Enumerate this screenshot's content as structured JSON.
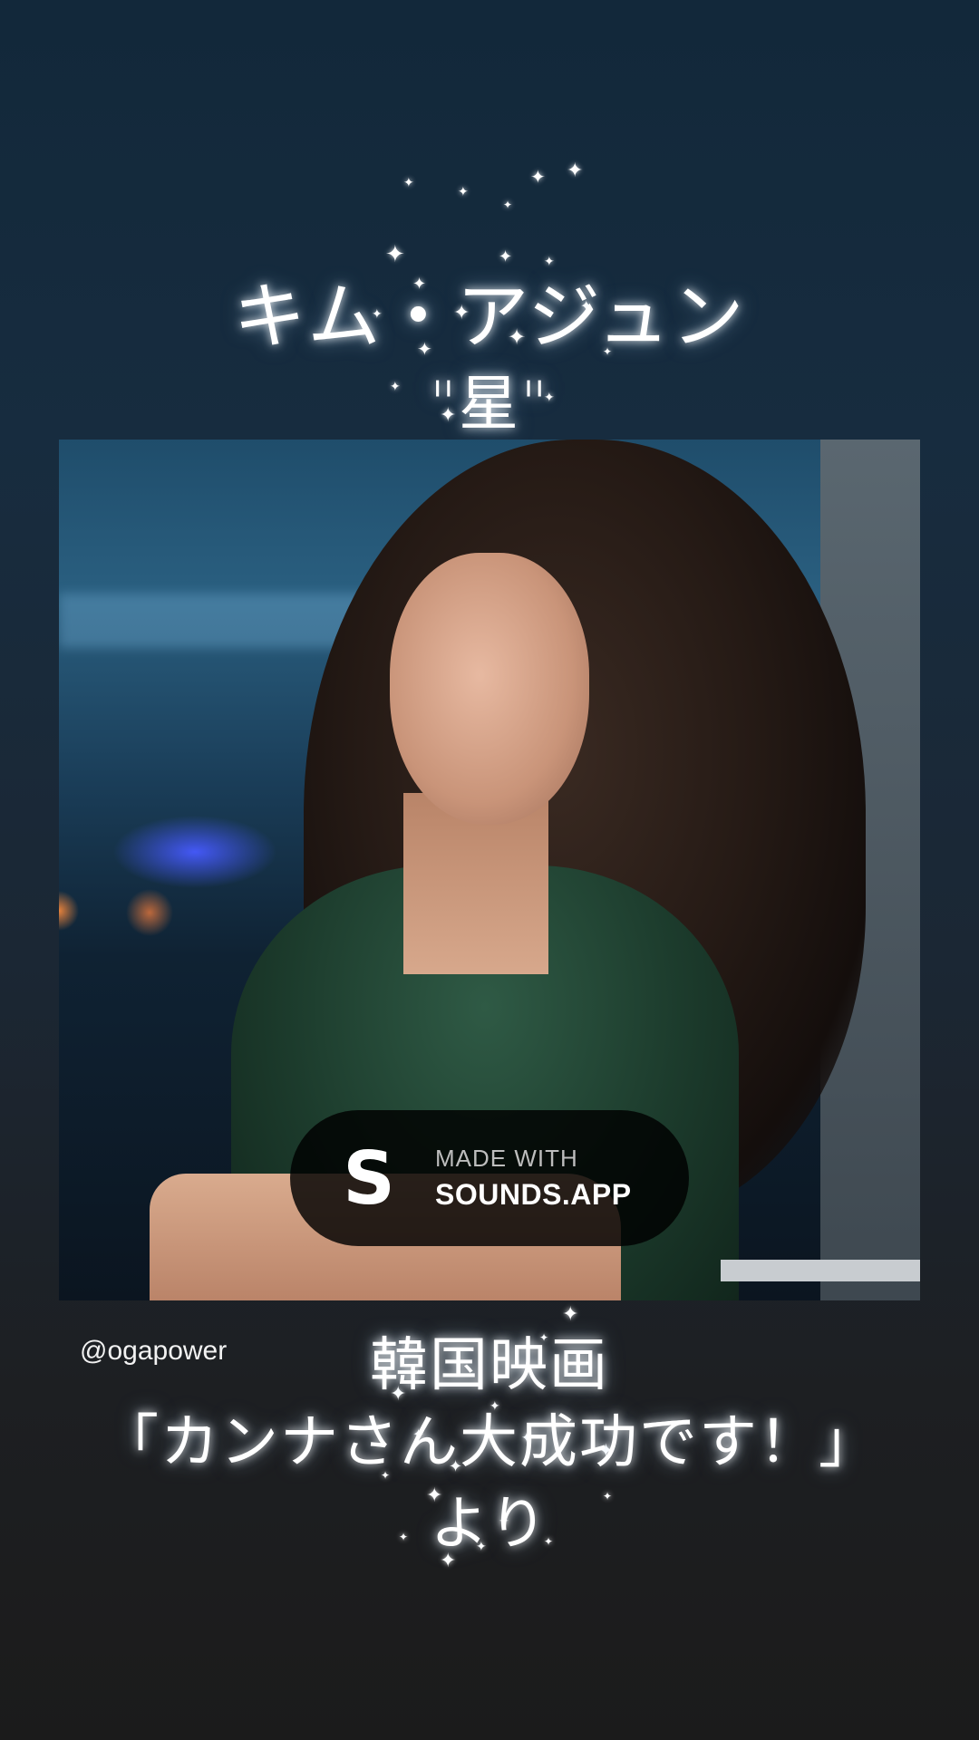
{
  "story": {
    "title_line1": "キム・アジュン",
    "title_line2": "\"星\"",
    "username": "@ogapower",
    "caption_line1": "韓国映画",
    "caption_line2": "「カンナさん大成功です！」",
    "caption_line3": "より"
  },
  "badge": {
    "icon_letter": "S",
    "line1": "MADE WITH",
    "line2": "SOUNDS.APP"
  },
  "colors": {
    "background_top": "#12283a",
    "background_bottom": "#1b1b1b",
    "badge_background": "#000000",
    "text": "#ffffff"
  },
  "icons": {
    "sparkle": "✦"
  }
}
